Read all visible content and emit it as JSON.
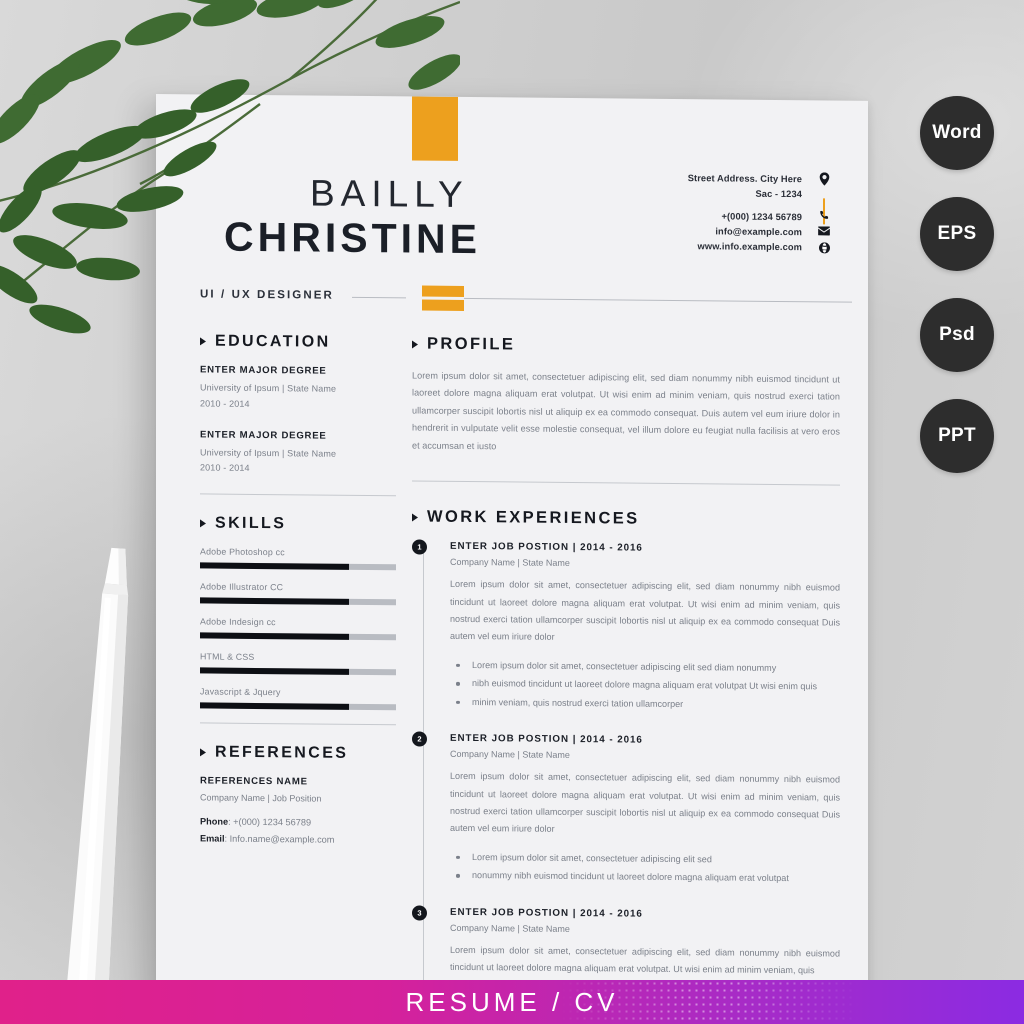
{
  "resume": {
    "name_first": "BAILLY",
    "name_last": "CHRISTINE",
    "role": "UI / UX DESIGNER",
    "contact": {
      "address_line1": "Street Address. City Here",
      "address_line2": "Sac - 1234",
      "phone": "+(000) 1234 56789",
      "email": "info@example.com",
      "website": "www.info.example.com",
      "icons": {
        "location": "location-pin-icon",
        "phone": "phone-icon",
        "email": "envelope-icon",
        "web": "globe-icon"
      }
    },
    "education": {
      "title": "EDUCATION",
      "items": [
        {
          "degree": "ENTER MAJOR DEGREE",
          "school": "University of Ipsum | State Name",
          "years": "2010 - 2014"
        },
        {
          "degree": "ENTER MAJOR DEGREE",
          "school": "University of Ipsum | State Name",
          "years": "2010 - 2014"
        }
      ]
    },
    "skills": {
      "title": "SKILLS",
      "items": [
        {
          "name": "Adobe Photoshop cc",
          "level": 76
        },
        {
          "name": "Adobe Illustrator CC",
          "level": 76
        },
        {
          "name": "Adobe Indesign cc",
          "level": 76
        },
        {
          "name": "HTML & CSS",
          "level": 76
        },
        {
          "name": "Javascript & Jquery",
          "level": 76
        }
      ]
    },
    "references": {
      "title": "REFERENCES",
      "name": "REFERENCES NAME",
      "company": "Company Name  | Job Position",
      "phone_label": "Phone",
      "phone_value": ":  +(000) 1234 56789",
      "email_label": "Email",
      "email_value": ":  Info.name@example.com"
    },
    "profile": {
      "title": "PROFILE",
      "text": "Lorem ipsum dolor sit amet, consectetuer adipiscing elit, sed diam nonummy nibh euismod tincidunt ut laoreet dolore magna aliquam erat volutpat. Ut wisi enim ad minim veniam, quis nostrud exerci tation ullamcorper suscipit lobortis nisl ut aliquip ex ea commodo consequat. Duis autem vel eum iriure dolor in hendrerit in vulputate velit esse molestie consequat, vel illum dolore eu feugiat nulla facilisis at vero eros et accumsan et iusto"
    },
    "work": {
      "title": "WORK EXPERIENCES",
      "jobs": [
        {
          "num": "1",
          "title": "ENTER JOB POSTION | 2014 - 2016",
          "company": "Company Name  | State Name",
          "desc": "Lorem ipsum dolor sit amet, consectetuer adipiscing elit, sed diam nonummy nibh euismod tincidunt ut laoreet dolore magna aliquam erat volutpat. Ut wisi enim ad minim veniam, quis nostrud exerci tation ullamcorper suscipit lobortis nisl ut aliquip ex ea commodo consequat Duis autem vel eum iriure dolor",
          "bullets": [
            "Lorem ipsum dolor sit amet, consectetuer adipiscing elit sed diam nonummy",
            "nibh euismod tincidunt ut laoreet dolore magna aliquam erat volutpat Ut wisi enim quis",
            "minim veniam, quis nostrud exerci tation ullamcorper"
          ]
        },
        {
          "num": "2",
          "title": "ENTER JOB POSTION | 2014 - 2016",
          "company": "Company Name  | State Name",
          "desc": "Lorem ipsum dolor sit amet, consectetuer adipiscing elit, sed diam nonummy nibh euismod tincidunt ut laoreet dolore magna aliquam erat volutpat. Ut wisi enim ad minim veniam, quis nostrud exerci tation ullamcorper suscipit lobortis nisl ut aliquip ex ea commodo consequat Duis autem vel eum iriure dolor",
          "bullets": [
            "Lorem ipsum dolor sit amet, consectetuer adipiscing elit sed",
            "nonummy nibh euismod tincidunt ut laoreet dolore magna aliquam erat volutpat"
          ]
        },
        {
          "num": "3",
          "title": "ENTER JOB POSTION | 2014 - 2016",
          "company": "Company Name  | State Name",
          "desc": "Lorem ipsum dolor sit amet, consectetuer adipiscing elit, sed diam nonummy nibh euismod tincidunt ut laoreet dolore magna aliquam erat volutpat. Ut wisi enim ad minim veniam, quis",
          "bullets": []
        }
      ]
    }
  },
  "badges": [
    {
      "label": "Word"
    },
    {
      "label": "EPS"
    },
    {
      "label": "Psd"
    },
    {
      "label": "PPT"
    }
  ],
  "banner": {
    "text": "RESUME / CV"
  },
  "colors": {
    "accent_yellow": "#eda01e",
    "ink": "#15181f",
    "muted": "#7b808a",
    "badge_bg": "#2d2d2d",
    "banner_start": "#e0218a",
    "banner_end": "#8b2be2"
  }
}
